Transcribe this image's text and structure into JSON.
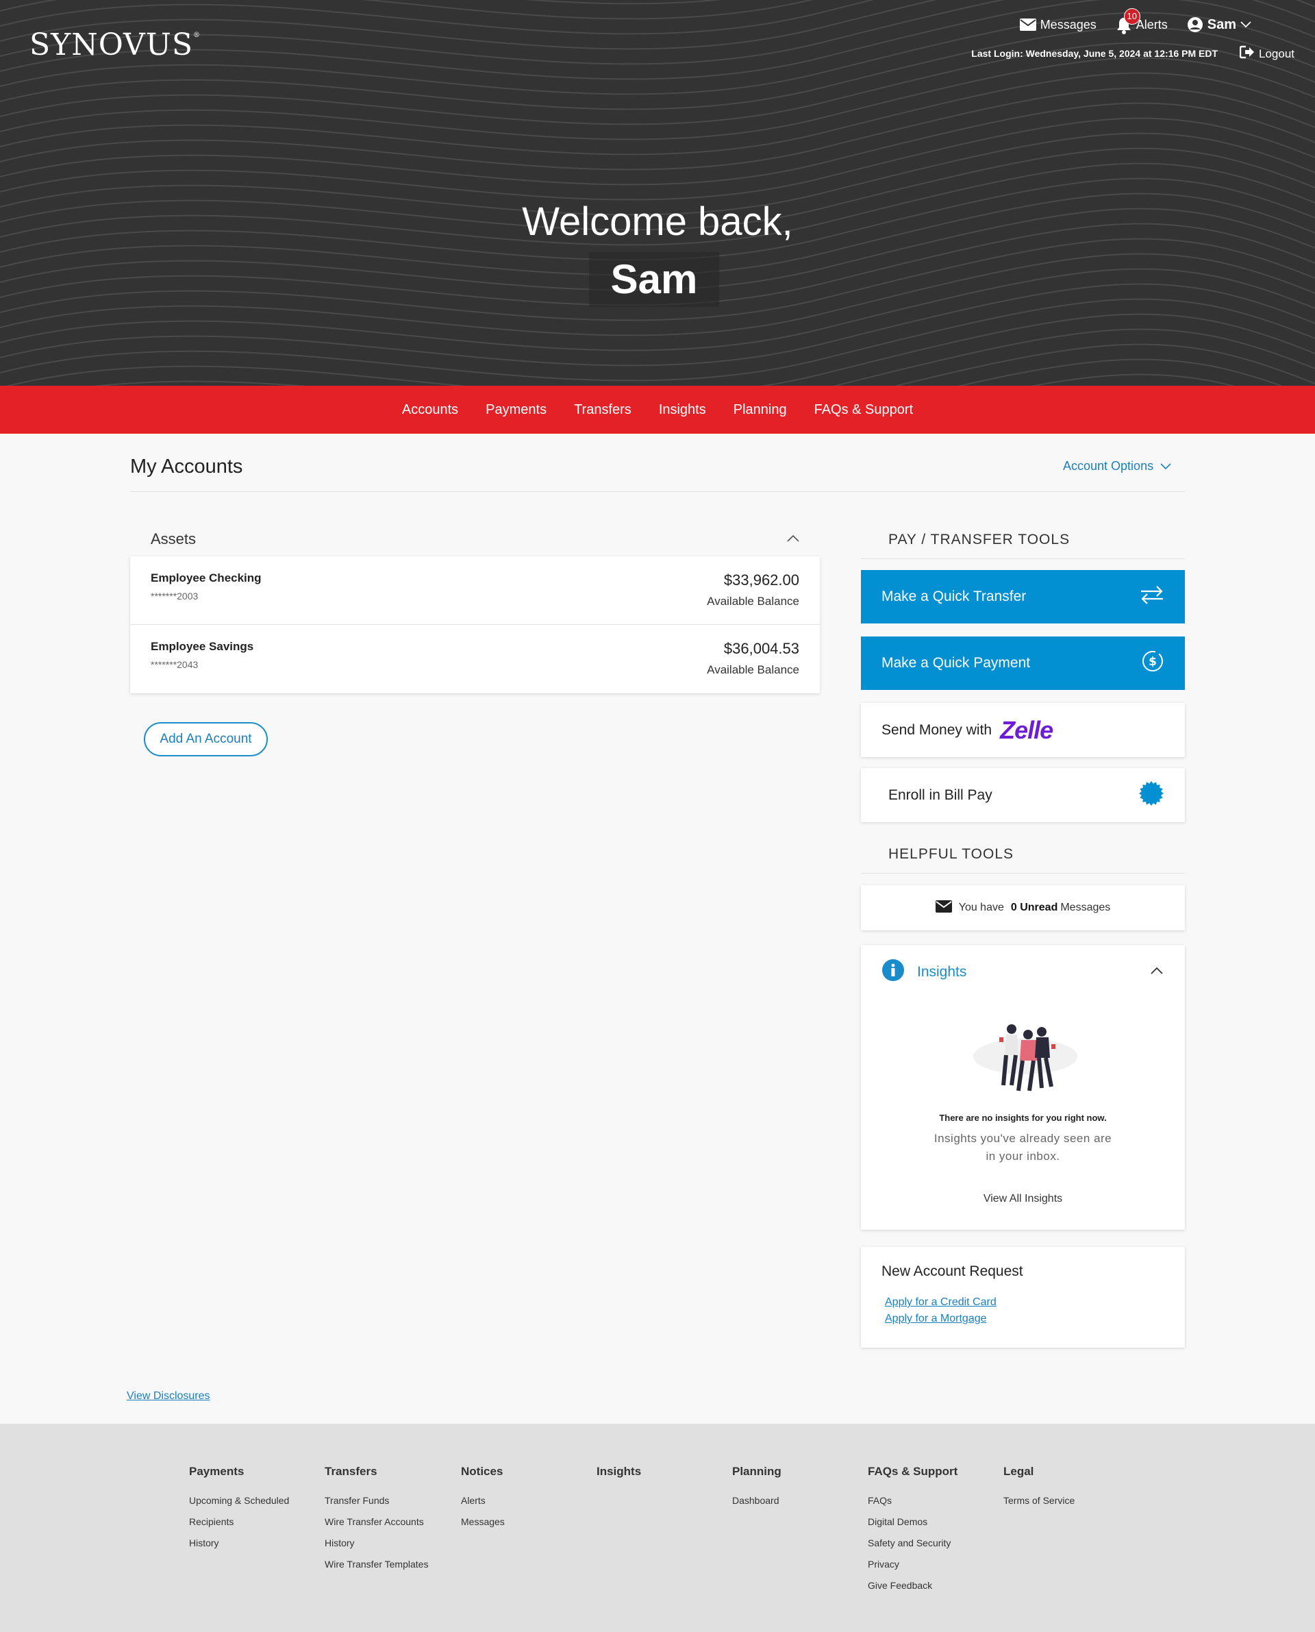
{
  "brand": {
    "name": "SYNOVUS",
    "mark": "®"
  },
  "header": {
    "messages_label": "Messages",
    "alerts_label": "Alerts",
    "alerts_count": "10",
    "user_name": "Sam",
    "last_login": "Last Login: Wednesday, June 5, 2024 at 12:16 PM EDT",
    "logout_label": "Logout"
  },
  "hero": {
    "welcome": "Welcome back,",
    "name": "Sam"
  },
  "nav": {
    "items": [
      "Accounts",
      "Payments",
      "Transfers",
      "Insights",
      "Planning",
      "FAQs & Support"
    ]
  },
  "accounts": {
    "title": "My Accounts",
    "options_label": "Account Options",
    "assets_title": "Assets",
    "rows": [
      {
        "name": "Employee Checking",
        "number": "*******2003",
        "amount": "$33,962.00",
        "label": "Available Balance"
      },
      {
        "name": "Employee Savings",
        "number": "*******2043",
        "amount": "$36,004.53",
        "label": "Available Balance"
      }
    ],
    "add_label": "Add An Account"
  },
  "tools": {
    "pay_title": "PAY / TRANSFER TOOLS",
    "quick_transfer": "Make a Quick Transfer",
    "quick_payment": "Make a Quick Payment",
    "send_money": "Send Money with",
    "zelle": "Zelle",
    "bill_pay": "Enroll in Bill Pay",
    "helpful_title": "HELPFUL TOOLS",
    "msg_prefix": "You have",
    "msg_count": "0 Unread",
    "msg_suffix": "Messages"
  },
  "insights": {
    "title": "Insights",
    "none": "There are no insights for you right now.",
    "seen": "Insights you've already seen are in your inbox.",
    "view_all": "View All Insights"
  },
  "new_account": {
    "title": "New Account Request",
    "credit_card": "Apply for a Credit Card",
    "mortgage": "Apply for a Mortgage"
  },
  "disclosures": "View Disclosures",
  "footer": {
    "columns": [
      {
        "head": "Payments",
        "links": [
          "Upcoming & Scheduled",
          "Recipients",
          "History"
        ]
      },
      {
        "head": "Transfers",
        "links": [
          "Transfer Funds",
          "Wire Transfer Accounts",
          "History",
          "Wire Transfer Templates"
        ]
      },
      {
        "head": "Notices",
        "links": [
          "Alerts",
          "Messages"
        ]
      },
      {
        "head": "Insights",
        "links": []
      },
      {
        "head": "Planning",
        "links": [
          "Dashboard"
        ]
      },
      {
        "head": "FAQs & Support",
        "links": [
          "FAQs",
          "Digital Demos",
          "Safety and Security",
          "Privacy",
          "Give Feedback"
        ]
      },
      {
        "head": "Legal",
        "links": [
          "Terms of Service"
        ]
      }
    ]
  },
  "colors": {
    "brand_red": "#e42127",
    "primary_blue": "#0390d2",
    "link_blue": "#1a7fc1",
    "zelle_purple": "#6d1ed4",
    "hero_bg": "#333333"
  }
}
